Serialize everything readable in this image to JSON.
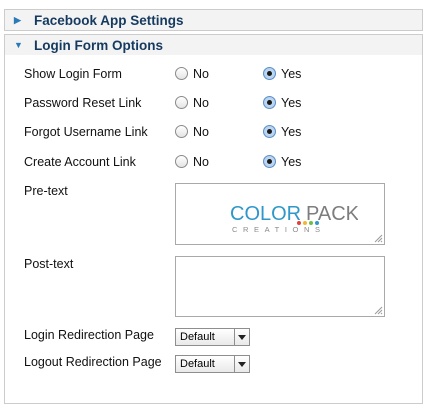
{
  "panels": {
    "facebook": {
      "title": "Facebook App Settings",
      "expanded": false
    },
    "login": {
      "title": "Login Form Options",
      "expanded": true
    }
  },
  "options": {
    "no_label": "No",
    "yes_label": "Yes",
    "show_login_form": {
      "label": "Show Login Form",
      "value": "Yes"
    },
    "password_reset": {
      "label": "Password Reset Link",
      "value": "Yes"
    },
    "forgot_username": {
      "label": "Forgot Username Link",
      "value": "Yes"
    },
    "create_account": {
      "label": "Create Account Link",
      "value": "Yes"
    }
  },
  "pretext": {
    "label": "Pre-text",
    "logo_main_a": "COLOR",
    "logo_main_b": "PACK",
    "logo_sub": "CREATIONS"
  },
  "posttext": {
    "label": "Post-text",
    "value": ""
  },
  "login_redirect": {
    "label": "Login Redirection Page",
    "selected": "Default"
  },
  "logout_redirect": {
    "label": "Logout Redirection Page",
    "selected": "Default"
  },
  "colors": {
    "header_text": "#163a5f",
    "accent": "#2a7ab8",
    "logo_blue": "#2f97c9",
    "logo_gray": "#7d7d7d"
  }
}
